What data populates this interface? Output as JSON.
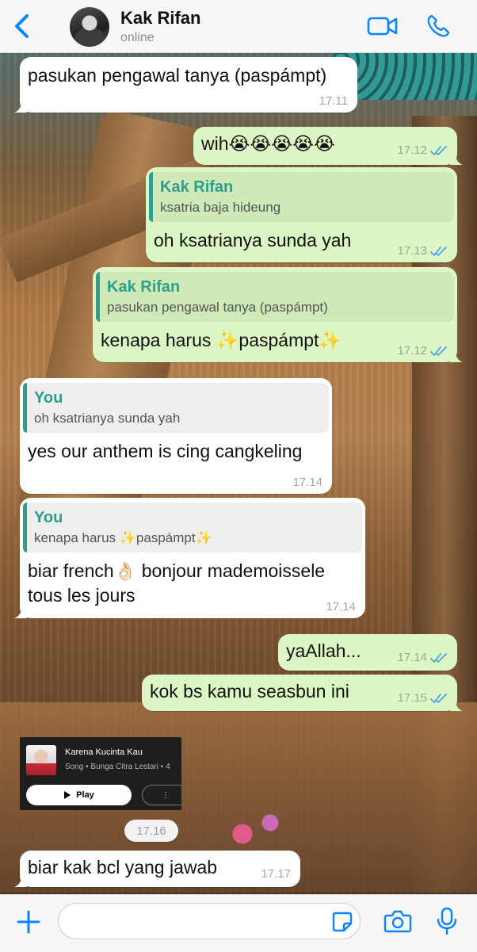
{
  "header": {
    "contact_name": "Kak Rifan",
    "status": "online",
    "accent_color": "#0b84ff"
  },
  "messages": [
    {
      "dir": "in",
      "text": "pasukan pengawal tanya (paspámpt)",
      "time": "17.11"
    },
    {
      "dir": "out",
      "text": "wih😭😭😭😭😭",
      "time": "17.12",
      "ticks": "read"
    },
    {
      "dir": "out",
      "quote_author": "Kak Rifan",
      "quote_text": "ksatria baja hideung",
      "text": "oh ksatrianya sunda yah",
      "time": "17.13",
      "ticks": "read"
    },
    {
      "dir": "out",
      "quote_author": "Kak Rifan",
      "quote_text": "pasukan pengawal tanya (paspámpt)",
      "text": "kenapa harus ✨paspámpt✨",
      "time": "17.12",
      "ticks": "read"
    },
    {
      "dir": "in",
      "quote_author": "You",
      "quote_text": "oh ksatrianya sunda yah",
      "text": "yes our anthem is cing cangkeling",
      "time": "17.14"
    },
    {
      "dir": "in",
      "quote_author": "You",
      "quote_text": "kenapa harus ✨paspámpt✨",
      "text": "biar french👌🏻 bonjour mademoissele\ntous les jours",
      "time": "17.14"
    },
    {
      "dir": "out",
      "text": "yaAllah...",
      "time": "17.14",
      "ticks": "read"
    },
    {
      "dir": "out",
      "text": "kok bs kamu seasbun ini",
      "time": "17.15",
      "ticks": "read"
    },
    {
      "dir": "in",
      "text": "biar kak bcl yang jawab",
      "time": "17.17"
    }
  ],
  "music_card": {
    "title": "Karena Kucinta Kau",
    "subtitle": "Song • Bunga Citra Lestari • 4",
    "play_label": "Play",
    "more_label": "⋮"
  },
  "time_chip": "17.16",
  "composer": {
    "placeholder": ""
  },
  "colors": {
    "outgoing_bubble": "#dcf7c5",
    "incoming_bubble": "#ffffff",
    "quote_accent": "#2e9f8c",
    "read_ticks": "#4fa3e0"
  }
}
